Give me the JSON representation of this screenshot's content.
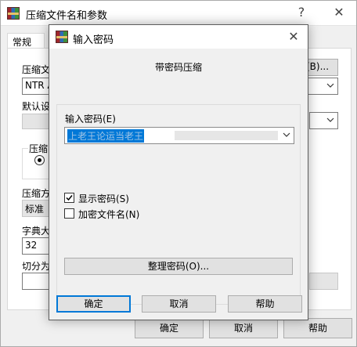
{
  "parent": {
    "title": "压缩文件名和参数",
    "help_glyph": "?",
    "close_glyph": "✕",
    "tab_general": "常规",
    "label_archive_name": "压缩文",
    "browse_label": "(B)...",
    "archive_name_value": "NTR A",
    "label_default_settings": "默认设",
    "label_archive_format": "压缩",
    "label_method": "压缩方",
    "method_value": "标准",
    "label_dictionary": "字典大",
    "dictionary_value": "32",
    "label_split": "切分为",
    "ok_label": "确定",
    "cancel_label": "取消",
    "help_label": "帮助"
  },
  "dialog": {
    "title": "输入密码",
    "close_glyph": "✕",
    "heading": "带密码压缩",
    "password_label": "输入密码(E)",
    "password_value": "上老王论运当老王",
    "show_password_label": "显示密码(S)",
    "show_password_checked": true,
    "encrypt_filenames_label": "加密文件名(N)",
    "encrypt_filenames_checked": false,
    "organize_label": "整理密码(O)...",
    "ok_label": "确定",
    "cancel_label": "取消",
    "help_label": "帮助"
  },
  "icons": {
    "app_icon": "winrar-icon",
    "dropdown": "chevron-down-icon",
    "check": "checkmark-icon"
  }
}
